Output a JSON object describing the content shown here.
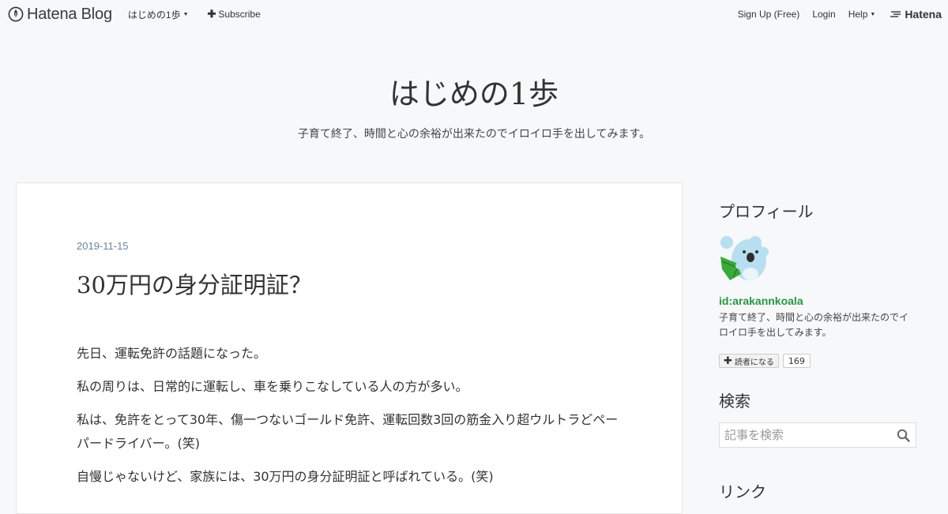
{
  "topbar": {
    "brand": "Hatena Blog",
    "blog_menu": "はじめの1歩",
    "subscribe": "Subscribe",
    "signup": "Sign Up (Free)",
    "login": "Login",
    "help": "Help",
    "hatena": "Hatena"
  },
  "blog": {
    "title": "はじめの1歩",
    "description": "子育て終了、時間と心の余裕が出来たのでイロイロ手を出してみます。"
  },
  "entry": {
    "date": "2019-11-15",
    "title": "30万円の身分証明証？",
    "paragraphs": [
      "先日、運転免許の話題になった。",
      "私の周りは、日常的に運転し、車を乗りこなしている人の方が多い。",
      "私は、免許をとって30年、傷一つないゴールド免許、運転回数3回の筋金入り超ウルトラどペーパードライバー。(笑)",
      "自慢じゃないけど、家族には、30万円の身分証明証と呼ばれている。(笑)"
    ]
  },
  "sidebar": {
    "profile_title": "プロフィール",
    "profile_id": "id:arakannkoala",
    "profile_desc": "子育て終了、時間と心の余裕が出来たのでイロイロ手を出してみます。",
    "reader_button": "読者になる",
    "reader_count": "169",
    "search_title": "検索",
    "search_placeholder": "記事を検索",
    "links_title": "リンク"
  }
}
